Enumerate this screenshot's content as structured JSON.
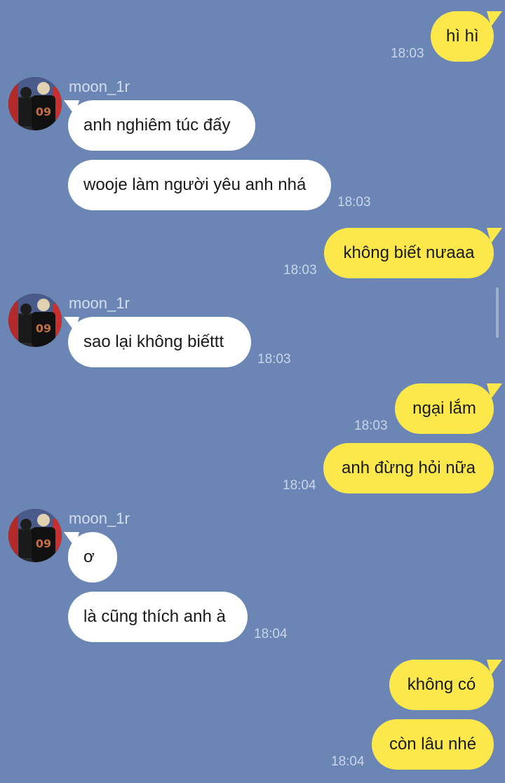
{
  "contact": {
    "name": "moon_1r"
  },
  "colors": {
    "background": "#6b86b4",
    "outgoing_bubble": "#fce84a",
    "incoming_bubble": "#ffffff"
  },
  "messages": [
    {
      "text": "hì hì",
      "time": "18:03",
      "from": "me"
    },
    {
      "text": "anh nghiêm túc đấy",
      "from": "moon_1r"
    },
    {
      "text": "wooje làm người yêu anh nhá",
      "time": "18:03",
      "from": "moon_1r"
    },
    {
      "text": "không biết nưaaa",
      "time": "18:03",
      "from": "me"
    },
    {
      "text": "sao lại không biếttt",
      "time": "18:03",
      "from": "moon_1r"
    },
    {
      "text": "ngại lắm",
      "time": "18:03",
      "from": "me"
    },
    {
      "text": "anh đừng hỏi nữa",
      "time": "18:04",
      "from": "me"
    },
    {
      "text": "ơ",
      "from": "moon_1r"
    },
    {
      "text": "là cũng thích anh à",
      "time": "18:04",
      "from": "moon_1r"
    },
    {
      "text": "không có",
      "from": "me"
    },
    {
      "text": "còn lâu nhé",
      "time": "18:04",
      "from": "me"
    }
  ]
}
